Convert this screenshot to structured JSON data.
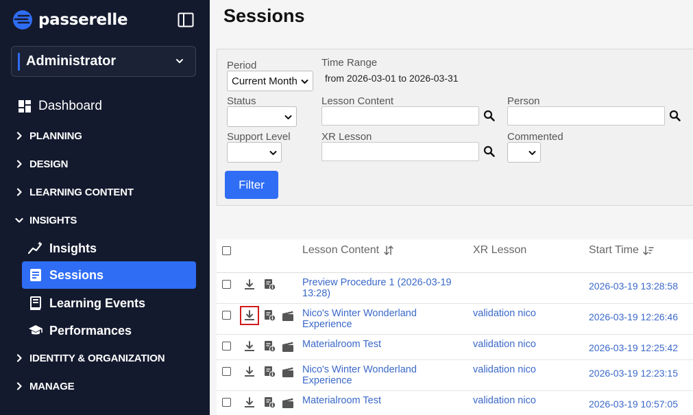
{
  "brand": {
    "name": "passerelle",
    "accent": "#2f6df5",
    "sidebar_bg": "#141a2e"
  },
  "role_select": {
    "value": "Administrator"
  },
  "nav": {
    "top": {
      "label": "Dashboard",
      "icon": "dashboard-icon"
    },
    "sections": [
      {
        "label": "PLANNING",
        "expanded": false
      },
      {
        "label": "DESIGN",
        "expanded": false
      },
      {
        "label": "LEARNING CONTENT",
        "expanded": false
      },
      {
        "label": "INSIGHTS",
        "expanded": true
      },
      {
        "label": "IDENTITY & ORGANIZATION",
        "expanded": false
      },
      {
        "label": "MANAGE",
        "expanded": false
      }
    ],
    "insights_items": [
      {
        "label": "Insights",
        "icon": "chart-line-icon",
        "active": false
      },
      {
        "label": "Sessions",
        "icon": "document-list-icon",
        "active": true
      },
      {
        "label": "Learning Events",
        "icon": "book-icon",
        "active": false
      },
      {
        "label": "Performances",
        "icon": "graduation-cap-icon",
        "active": false
      }
    ]
  },
  "page": {
    "title": "Sessions"
  },
  "filters": {
    "period": {
      "label": "Period",
      "value": "Current Month"
    },
    "time_range": {
      "label": "Time Range",
      "value": "from 2026-03-01 to 2026-03-31"
    },
    "status": {
      "label": "Status",
      "value": ""
    },
    "lesson_content": {
      "label": "Lesson Content",
      "value": ""
    },
    "person": {
      "label": "Person",
      "value": ""
    },
    "support_level": {
      "label": "Support Level",
      "value": ""
    },
    "xr_lesson": {
      "label": "XR Lesson",
      "value": ""
    },
    "commented": {
      "label": "Commented",
      "value": ""
    },
    "button": "Filter"
  },
  "table": {
    "columns": {
      "lesson_content": "Lesson Content",
      "xr_lesson": "XR Lesson",
      "start_time": "Start Time"
    },
    "rows": [
      {
        "lesson": "Preview Procedure 1 (2026-03-19 13:28)",
        "xr": "",
        "start": "2026-03-19 13:28:58",
        "has_media": false
      },
      {
        "lesson": "Nico's Winter Wonderland Experience",
        "xr": "validation nico",
        "start": "2026-03-19 12:26:46",
        "has_media": true
      },
      {
        "lesson": "Materialroom Test",
        "xr": "validation nico",
        "start": "2026-03-19 12:25:42",
        "has_media": true
      },
      {
        "lesson": "Nico's Winter Wonderland Experience",
        "xr": "validation nico",
        "start": "2026-03-19 12:23:15",
        "has_media": true
      },
      {
        "lesson": "Materialroom Test",
        "xr": "validation nico",
        "start": "2026-03-19 10:57:05",
        "has_media": true
      }
    ]
  }
}
